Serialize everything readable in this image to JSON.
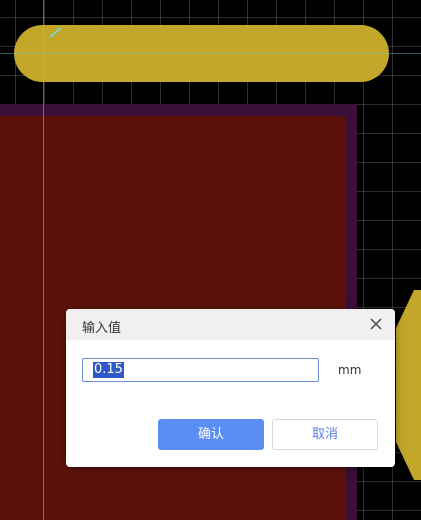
{
  "dialog": {
    "title": "输入值",
    "input_value": "0.15",
    "unit": "mm",
    "confirm_label": "确认",
    "cancel_label": "取消",
    "close_icon": "close-icon"
  },
  "colors": {
    "canvas_bg": "#000000",
    "pad": "#c3a72a",
    "copper_fill": "#5c120a",
    "copper_outline": "#3a0f38",
    "accent": "#5a8ef5",
    "selection": "#2f58c9"
  }
}
